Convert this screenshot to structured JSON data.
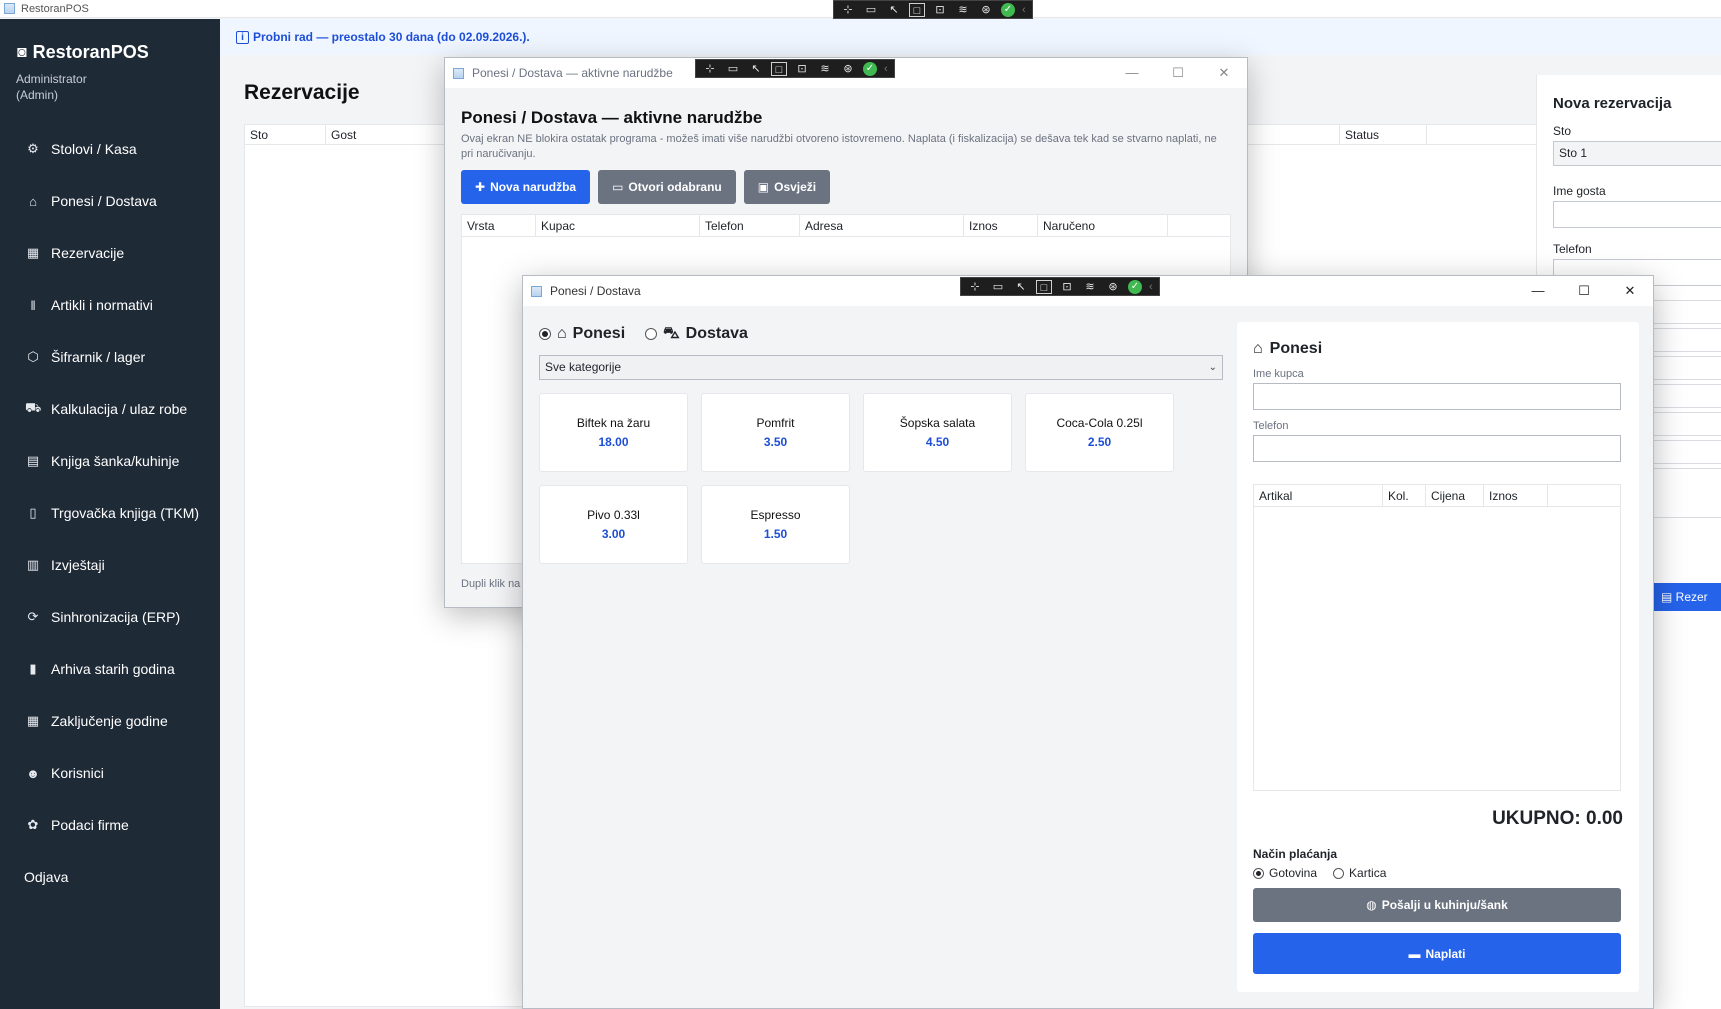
{
  "app": {
    "title": "RestoranPOS",
    "brand": "RestoranPOS",
    "user_name": "Administrator",
    "user_role": "(Admin)"
  },
  "sidebar": {
    "items": [
      {
        "label": "Stolovi / Kasa",
        "icon": "⚙"
      },
      {
        "label": "Ponesi / Dostava",
        "icon": "⌂"
      },
      {
        "label": "Rezervacije",
        "icon": "▦"
      },
      {
        "label": "Artikli i normativi",
        "icon": "ǁ"
      },
      {
        "label": "Šifrarnik / lager",
        "icon": "⬡"
      },
      {
        "label": "Kalkulacija / ulaz robe",
        "icon": "⛟"
      },
      {
        "label": "Knjiga šanka/kuhinje",
        "icon": "▤"
      },
      {
        "label": "Trgovačka knjiga (TKM)",
        "icon": "▯"
      },
      {
        "label": "Izvještaji",
        "icon": "▥"
      },
      {
        "label": "Sinhronizacija (ERP)",
        "icon": "⟳"
      },
      {
        "label": "Arhiva starih godina",
        "icon": "▮"
      },
      {
        "label": "Zaključenje godine",
        "icon": "▦"
      },
      {
        "label": "Korisnici",
        "icon": "☻"
      },
      {
        "label": "Podaci firme",
        "icon": "✿"
      }
    ],
    "logout": "Odjava"
  },
  "trial": {
    "text": "Probni rad — preostalo 30 dana (do 02.09.2026.)."
  },
  "reservations": {
    "title": "Rezervacije",
    "columns": [
      "Sto",
      "Gost",
      "Status"
    ]
  },
  "new_reservation": {
    "title": "Nova rezervacija",
    "table_label": "Sto",
    "table_value": "Sto 1",
    "guest_label": "Ime gosta",
    "phone_label": "Telefon",
    "submit_label": "Rezer"
  },
  "orders_window": {
    "window_title": "Ponesi / Dostava — aktivne narudžbe",
    "heading": "Ponesi / Dostava — aktivne narudžbe",
    "hint": "Ovaj ekran NE blokira ostatak programa - možeš imati više narudžbi otvoreno istovremeno. Naplata (i fiskalizacija) se dešava tek kad se stvarno naplati, ne pri naručivanju.",
    "btn_new": "Nova narudžba",
    "btn_open": "Otvori odabranu",
    "btn_refresh": "Osvježi",
    "columns": [
      "Vrsta",
      "Kupac",
      "Telefon",
      "Adresa",
      "Iznos",
      "Naručeno"
    ],
    "footer_hint": "Dupli klik na"
  },
  "order_window": {
    "window_title": "Ponesi / Dostava",
    "mode_takeaway": "Ponesi",
    "mode_delivery": "Dostava",
    "category": "Sve kategorije",
    "products": [
      {
        "name": "Biftek na žaru",
        "price": "18.00"
      },
      {
        "name": "Pomfrit",
        "price": "3.50"
      },
      {
        "name": "Šopska salata",
        "price": "4.50"
      },
      {
        "name": "Coca-Cola 0.25l",
        "price": "2.50"
      },
      {
        "name": "Pivo 0.33l",
        "price": "3.00"
      },
      {
        "name": "Espresso",
        "price": "1.50"
      }
    ],
    "cart": {
      "title": "Ponesi",
      "customer_label": "Ime kupca",
      "phone_label": "Telefon",
      "columns": [
        "Artikal",
        "Kol.",
        "Cijena",
        "Iznos"
      ],
      "total": "UKUPNO: 0.00",
      "payment_label": "Način plaćanja",
      "pay_cash": "Gotovina",
      "pay_card": "Kartica",
      "btn_send": "Pošalji u kuhinju/šank",
      "btn_pay": "Naplati"
    }
  },
  "colors": {
    "sidebar": "#1f2a37",
    "accent": "#2563eb",
    "gray_button": "#6b7280"
  }
}
